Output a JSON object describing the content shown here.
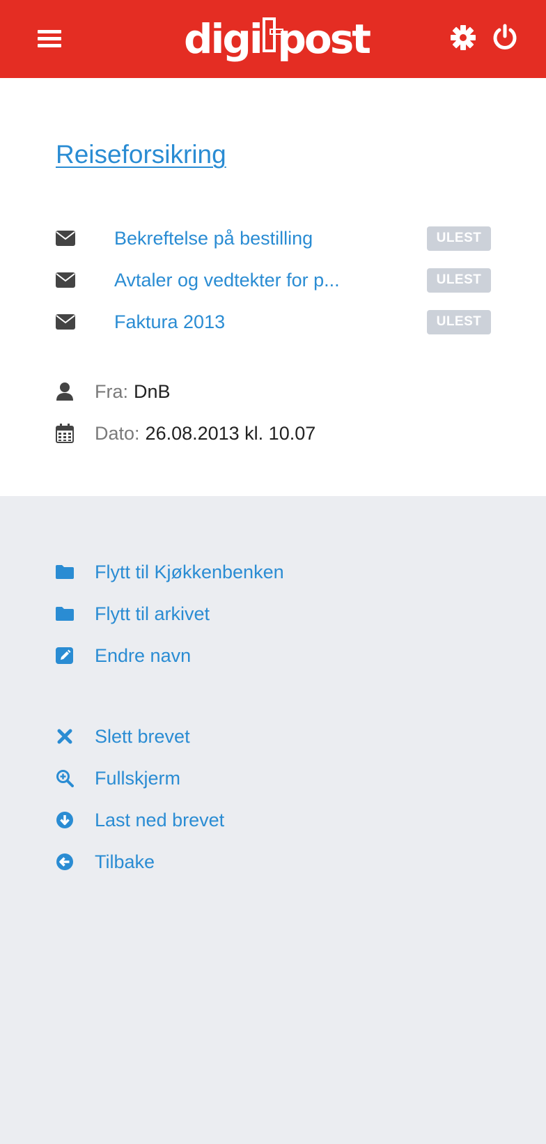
{
  "header": {
    "logo_text_left": "digi",
    "logo_text_right": "post",
    "brand_color": "#e42d23"
  },
  "letter": {
    "title": "Reiseforsikring",
    "documents": [
      {
        "name": "Bekreftelse på bestilling",
        "badge": "ULEST",
        "icon": "envelope-icon"
      },
      {
        "name": "Avtaler og vedtekter for p...",
        "badge": "ULEST",
        "icon": "envelope-icon"
      },
      {
        "name": "Faktura 2013",
        "badge": "ULEST",
        "icon": "envelope-icon"
      }
    ],
    "from_label": "Fra:",
    "from_value": "DnB",
    "date_label": "Dato:",
    "date_value": "26.08.2013 kl. 10.07"
  },
  "actions": {
    "move_kitchen": "Flytt til Kjøkkenbenken",
    "move_archive": "Flytt til arkivet",
    "rename": "Endre navn",
    "delete": "Slett brevet",
    "fullscreen": "Fullskjerm",
    "download": "Last ned brevet",
    "back": "Tilbake"
  },
  "colors": {
    "link": "#2a8cd3",
    "badge_bg": "#ccd1d9",
    "page_bg": "#ebedf1"
  }
}
